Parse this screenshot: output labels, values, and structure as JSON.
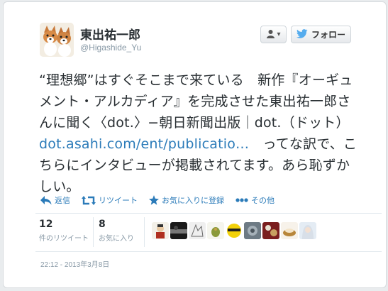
{
  "user": {
    "display_name": "東出祐一郎",
    "screen_name": "@Higashide_Yu"
  },
  "buttons": {
    "user_menu_caret": "▾",
    "follow_label": "フォロー"
  },
  "tweet": {
    "text_part1": "“理想郷”はすぐそこまで来ている　新作『オーギュメント・アルカディア』を完成させた東出祐一郎さんに聞く〈dot.〉−朝日新聞出版｜dot.（ドット）",
    "link": "dot.asahi.com/ent/publicatio…",
    "text_part2": "　ってな訳で、こちらにインタビューが掲載されてます。あら恥ずかしい。"
  },
  "actions": {
    "reply": "返信",
    "retweet": "リツイート",
    "favorite": "お気に入りに登録",
    "more": "その他"
  },
  "stats": {
    "retweets_count": "12",
    "retweets_label": "件のリツイート",
    "favorites_count": "8",
    "favorites_label": "お気に入り"
  },
  "favoriters": [
    "face-1",
    "face-2",
    "face-3",
    "face-4",
    "face-5",
    "face-6",
    "face-7",
    "face-8",
    "face-9"
  ],
  "timestamp": "22:12 - 2013年3月8日",
  "colors": {
    "link": "#2b7bb9",
    "follow_bird": "#55acee"
  }
}
